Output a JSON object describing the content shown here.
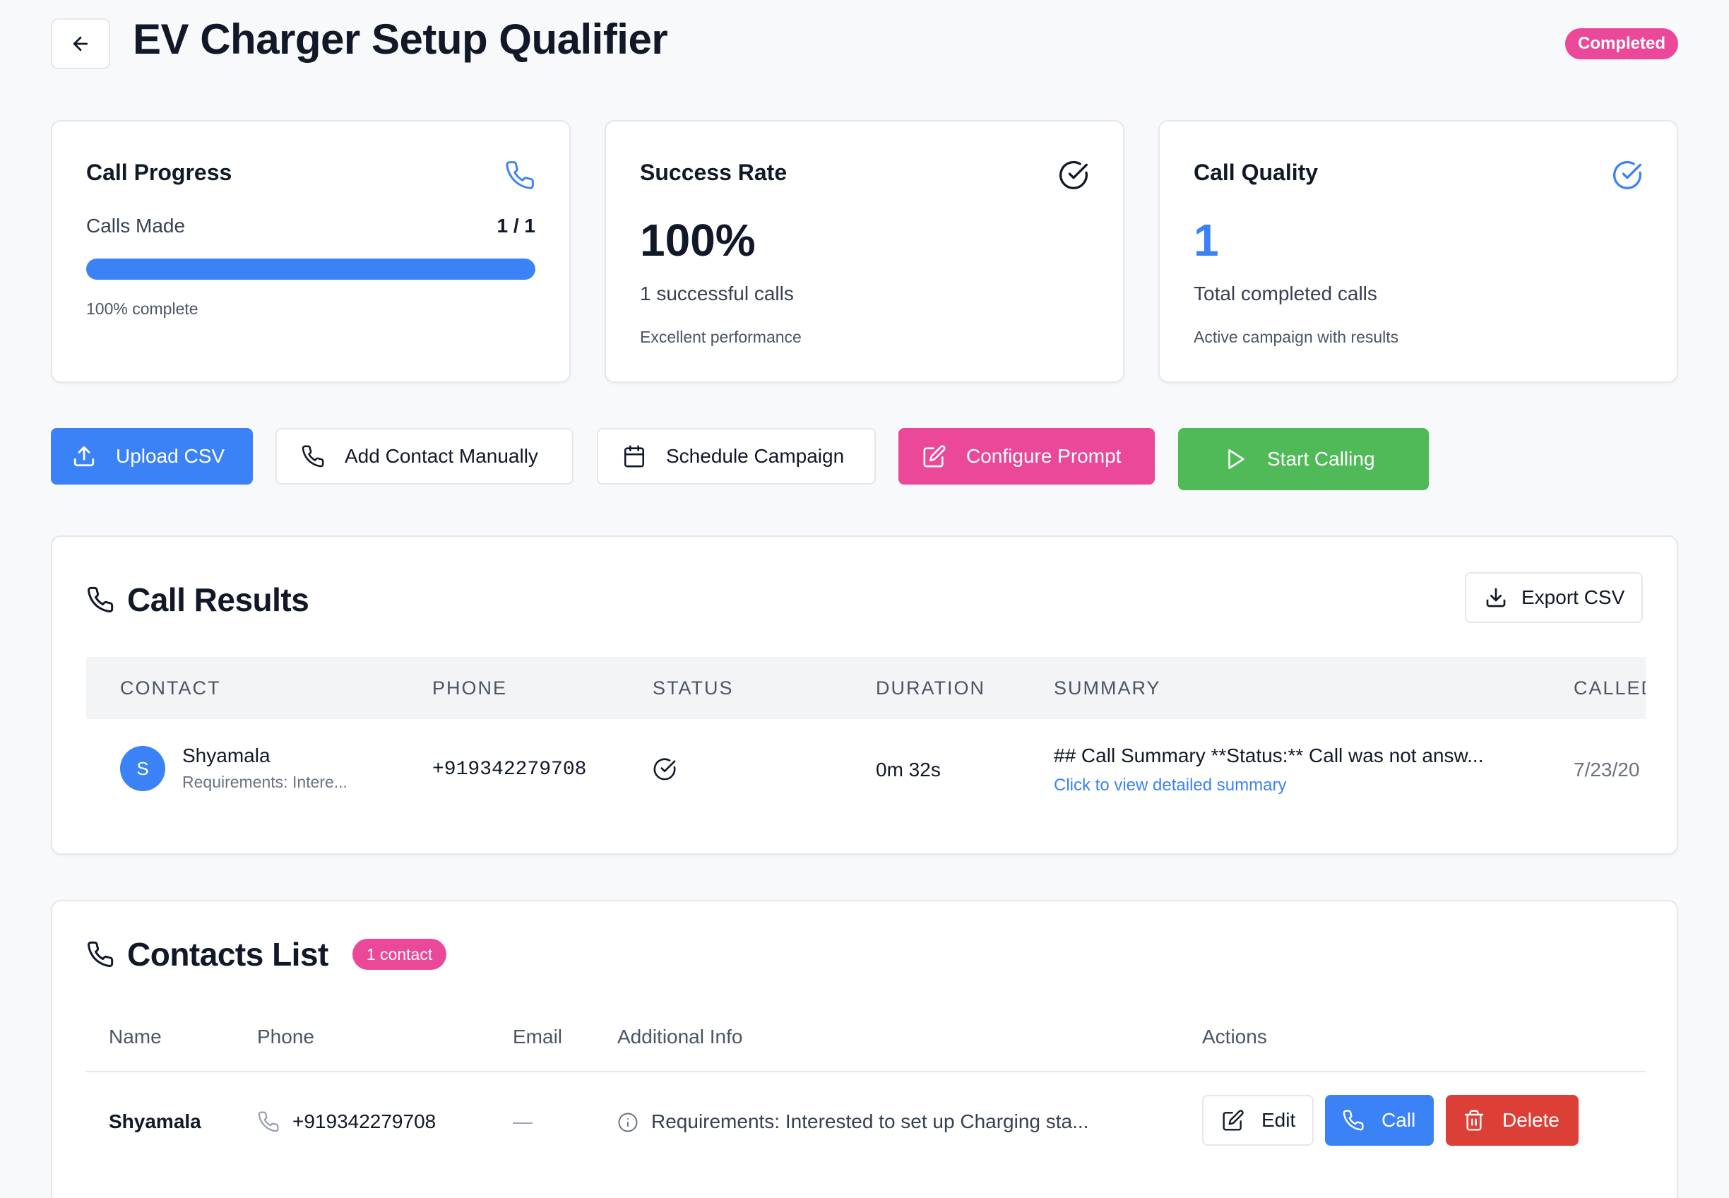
{
  "header": {
    "title": "EV Charger Setup Qualifier",
    "status": "Completed"
  },
  "stats": {
    "call_progress": {
      "title": "Call Progress",
      "label": "Calls Made",
      "value": "1 / 1",
      "progress_fraction": 1.0,
      "note": "100% complete"
    },
    "success_rate": {
      "title": "Success Rate",
      "value": "100%",
      "line1": "1 successful calls",
      "line2": "Excellent performance"
    },
    "call_quality": {
      "title": "Call Quality",
      "value": "1",
      "line1": "Total completed calls",
      "line2": "Active campaign with results"
    }
  },
  "actions": {
    "upload_csv": "Upload CSV",
    "add_contact": "Add Contact Manually",
    "schedule": "Schedule Campaign",
    "configure_prompt": "Configure Prompt",
    "start_calling": "Start Calling"
  },
  "call_results": {
    "title": "Call Results",
    "export_label": "Export CSV",
    "columns": [
      "CONTACT",
      "PHONE",
      "STATUS",
      "DURATION",
      "SUMMARY",
      "CALLED"
    ],
    "rows": [
      {
        "avatar_initial": "S",
        "name": "Shyamala",
        "sub": "Requirements: Intere...",
        "phone": "+919342279708",
        "status_icon": "check-circle-icon",
        "duration": "0m 32s",
        "summary": "## Call Summary **Status:** Call was not answ...",
        "summary_link": "Click to view detailed summary",
        "called": "7/23/20"
      }
    ]
  },
  "contacts": {
    "title": "Contacts List",
    "count_badge": "1 contact",
    "columns": [
      "Name",
      "Phone",
      "Email",
      "Additional Info",
      "Actions"
    ],
    "rows": [
      {
        "name": "Shyamala",
        "phone": "+919342279708",
        "email": "—",
        "info": "Requirements: Interested to set up Charging sta...",
        "edit_label": "Edit",
        "call_label": "Call",
        "delete_label": "Delete"
      }
    ]
  },
  "colors": {
    "accent_blue": "#3b82f6",
    "pink": "#ec4899",
    "green": "#4fba57",
    "red": "#dc3f36"
  }
}
